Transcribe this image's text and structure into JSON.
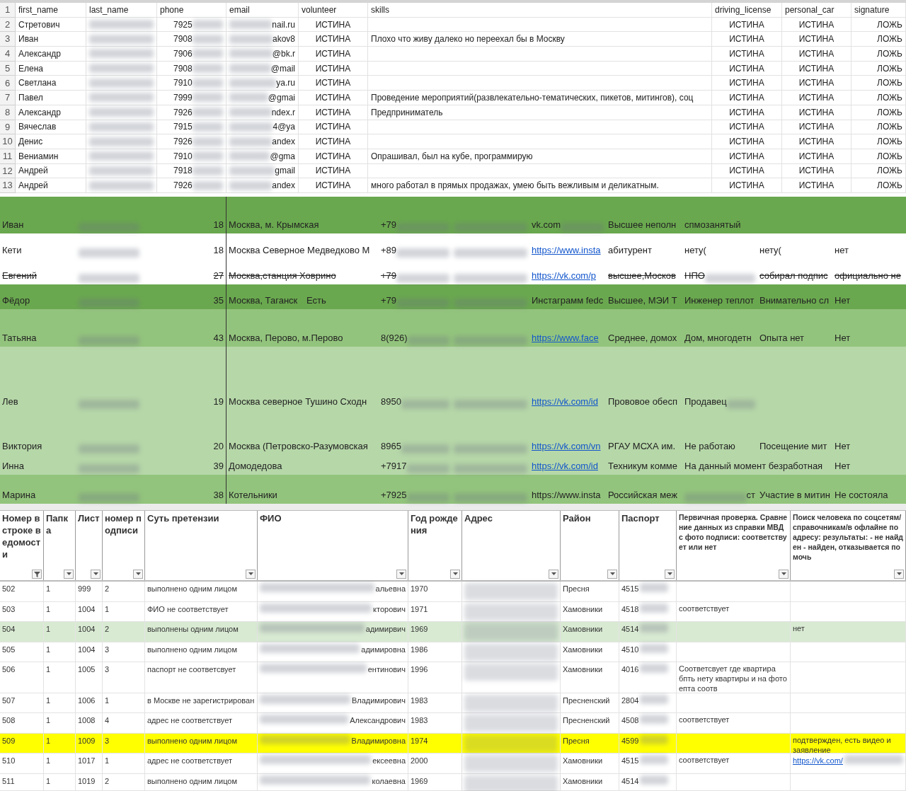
{
  "sheet_1": {
    "header_number": "1",
    "headers": [
      "first_name",
      "last_name",
      "phone",
      "email",
      "volunteer",
      "skills",
      "driving_license",
      "personal_car",
      "signature"
    ],
    "rows": [
      {
        "number": "2",
        "first_name": "Стретович",
        "phone": "7925",
        "email": "nail.ru",
        "volunteer": "ИСТИНА",
        "driving_license": "ИСТИНА",
        "personal_car": "ИСТИНА",
        "signature": "ЛОЖЬ"
      },
      {
        "number": "3",
        "first_name": "Иван",
        "phone": "7908",
        "email": "akov8",
        "volunteer": "ИСТИНА",
        "skills": "Плохо что живу далеко но переехал бы в Москву",
        "driving_license": "ИСТИНА",
        "personal_car": "ИСТИНА",
        "signature": "ЛОЖЬ"
      },
      {
        "number": "4",
        "first_name": "Александр",
        "phone": "7906",
        "email": "@bk.r",
        "volunteer": "ИСТИНА",
        "driving_license": "ИСТИНА",
        "personal_car": "ИСТИНА",
        "signature": "ЛОЖЬ"
      },
      {
        "number": "5",
        "first_name": "Елена",
        "phone": "7908",
        "email": "@mail",
        "volunteer": "ИСТИНА",
        "driving_license": "ИСТИНА",
        "personal_car": "ИСТИНА",
        "signature": "ЛОЖЬ"
      },
      {
        "number": "6",
        "first_name": "Светлана",
        "phone": "7910",
        "email": "ya.ru",
        "volunteer": "ИСТИНА",
        "driving_license": "ИСТИНА",
        "personal_car": "ИСТИНА",
        "signature": "ЛОЖЬ"
      },
      {
        "number": "7",
        "first_name": "Павел",
        "phone": "7999",
        "email": "@gmai",
        "volunteer": "ИСТИНА",
        "skills": "Проведение мероприятий(развлекательно-тематических, пикетов, митингов), соц",
        "driving_license": "ИСТИНА",
        "personal_car": "ИСТИНА",
        "signature": "ЛОЖЬ"
      },
      {
        "number": "8",
        "first_name": "Александр",
        "phone": "7926",
        "email": "ndex.r",
        "volunteer": "ИСТИНА",
        "skills": "Предприниматель",
        "driving_license": "ИСТИНА",
        "personal_car": "ИСТИНА",
        "signature": "ЛОЖЬ"
      },
      {
        "number": "9",
        "first_name": "Вячеслав",
        "phone": "7915",
        "email": "4@ya",
        "volunteer": "ИСТИНА",
        "driving_license": "ИСТИНА",
        "personal_car": "ИСТИНА",
        "signature": "ЛОЖЬ"
      },
      {
        "number": "10",
        "first_name": "Денис",
        "phone": "7926",
        "email": "andex",
        "volunteer": "ИСТИНА",
        "driving_license": "ИСТИНА",
        "personal_car": "ИСТИНА",
        "signature": "ЛОЖЬ"
      },
      {
        "number": "11",
        "first_name": "Вениамин",
        "phone": "7910",
        "email": "@gma",
        "volunteer": "ИСТИНА",
        "skills": "Опрашивал, был на кубе, программирую",
        "driving_license": "ИСТИНА",
        "personal_car": "ИСТИНА",
        "signature": "ЛОЖЬ"
      },
      {
        "number": "12",
        "first_name": "Андрей",
        "phone": "7918",
        "email": "gmail",
        "volunteer": "ИСТИНА",
        "driving_license": "ИСТИНА",
        "personal_car": "ИСТИНА",
        "signature": "ЛОЖЬ"
      },
      {
        "number": "13",
        "first_name": "Андрей",
        "phone": "7926",
        "email": "andex",
        "volunteer": "ИСТИНА",
        "skills": "много работал в прямых продажах, умею быть вежливым и деликатным.",
        "driving_license": "ИСТИНА",
        "personal_car": "ИСТИНА",
        "signature": "ЛОЖЬ"
      }
    ]
  },
  "sheet_2": {
    "rows": [
      {
        "color": "#6aa84f",
        "struck": false,
        "name": "Иван",
        "age": "18",
        "address": "Москва, м. Крымская",
        "phone": "+79",
        "column_8": {
          "text": "vk.com",
          "blur_after": true
        },
        "column_9": "Высшее неполн",
        "column_10": "спмозанятый"
      },
      {
        "color": "#ffffff",
        "struck": false,
        "name": "Кети",
        "age": "18",
        "address": "Москва Северное Медведково М",
        "phone": "+89",
        "column_8": {
          "text": "https://www.insta",
          "link": true
        },
        "column_9": "абитурент",
        "column_10": "нету(",
        "column_11": "нету(",
        "column_12": "нет"
      },
      {
        "color": "#ffffff",
        "struck": true,
        "name": "Евгений",
        "age": "27",
        "address": "Москва,станция Ховрино",
        "phone": "+79",
        "column_8": {
          "text": "https://vk.com/p",
          "link": true
        },
        "column_9": "высшее,Москов",
        "column_10": {
          "text": "НПО",
          "blur_after": true
        },
        "column_11": "собирал подпис",
        "column_12": "официально не"
      },
      {
        "color": "#6aa84f",
        "struck": false,
        "name": "Фёдор",
        "age": "35",
        "address": "Москва, Таганск",
        "column_5": "Есть",
        "phone": "+79",
        "column_8": "Инстаграмм fedc",
        "column_9": "Высшее, МЭИ Т",
        "column_10": "Инженер теплот",
        "column_11": "Внимательно сл",
        "column_12": "Нет"
      },
      {
        "color": "#93c47d",
        "struck": false,
        "name": "Татьяна",
        "age": "43",
        "address": "Москва, Перово, м.Перово",
        "phone": "8(926)",
        "column_8": {
          "text": "https://www.face",
          "link": true
        },
        "column_9": "Среднее, домох",
        "column_10": "Дом, многодетн",
        "column_11": "Опыта нет",
        "column_12": "Нет"
      },
      {
        "color": "#b6d7a8",
        "struck": false,
        "name": "Лев",
        "age": "19",
        "address": "Москва северное Тушино Сходн",
        "phone": "8950",
        "column_8": {
          "text": "https://vk.com/id",
          "link": true
        },
        "column_9": "Прововое обесп",
        "column_10": {
          "text": "Продавец",
          "blur_after": true
        }
      },
      {
        "color": "#b6d7a8",
        "struck": false,
        "name": "Виктория",
        "age": "20",
        "address": "Москва (Петровско-Разумовская",
        "phone": "8965",
        "column_8": {
          "text": "https://vk.com/vn",
          "link": true
        },
        "column_9": "РГАУ МСХА им.",
        "column_10": "Не работаю",
        "column_11": "Посещение мит",
        "column_12": "Нет"
      },
      {
        "color": "#b6d7a8",
        "struck": false,
        "name": "Инна",
        "age": "39",
        "address": "Домодедова",
        "phone": "+7917",
        "column_8": {
          "text": "https://vk.com/id",
          "link": true
        },
        "column_9": "Техникум комме",
        "column_10": "На данный момент безработная",
        "column_12": "Нет"
      },
      {
        "color": "#93c47d",
        "struck": false,
        "name": "Марина",
        "age": "38",
        "address": "Котельники",
        "phone": "+7925",
        "column_8": "https://www.insta",
        "column_9": "Российская меж",
        "column_10": {
          "text": "ст",
          "blur_before": true
        },
        "column_11": "Участие в митин",
        "column_12": "Не состояла"
      }
    ]
  },
  "sheet_3": {
    "headers": [
      {
        "title": "Номер в строке ведомости",
        "filtered": true
      },
      {
        "title": "Папка",
        "filtered": false
      },
      {
        "title": "Лист",
        "filtered": false
      },
      {
        "title": "номер подписи",
        "filtered": false
      },
      {
        "title": "Суть претензии",
        "filtered": false
      },
      {
        "title": "ФИО",
        "filtered": false
      },
      {
        "title": "Год рождения",
        "filtered": false
      },
      {
        "title": "Адрес",
        "filtered": false
      },
      {
        "title": "Район",
        "filtered": false
      },
      {
        "title": "Паспорт",
        "filtered": false
      },
      {
        "title": "Первичная проверка. Сравнение данных из справки МВД с фото подписи: соответствует или нет",
        "filtered": false
      },
      {
        "title": "Поиск человека по соцсетям/справочникам/в офлайне по адресу: результаты: - не найден - найден, отказывается помочь",
        "filtered": false
      }
    ],
    "rows": [
      {
        "number": "502",
        "folder": "1",
        "sheet": "999",
        "signature_no": "2",
        "claim": "выполнено одним лицом",
        "fio": "альевна",
        "year": "1970",
        "district": "Пресня",
        "passport": "4515"
      },
      {
        "number": "503",
        "folder": "1",
        "sheet": "1004",
        "signature_no": "1",
        "claim": "ФИО не соответствует",
        "fio": "кторович",
        "year": "1971",
        "district": "Хамовники",
        "passport": "4518",
        "check": "соответствует"
      },
      {
        "color": "#d9ead3",
        "number": "504",
        "folder": "1",
        "sheet": "1004",
        "signature_no": "2",
        "claim": "выполнены одним лицом",
        "fio": "адимирвич",
        "year": "1969",
        "district": "Хамовники",
        "passport": "4514",
        "search": "нет"
      },
      {
        "number": "505",
        "folder": "1",
        "sheet": "1004",
        "signature_no": "3",
        "claim": "выполнено одним лицом",
        "fio": "адимировна",
        "year": "1986",
        "district": "Хамовники",
        "passport": "4510"
      },
      {
        "number": "506",
        "folder": "1",
        "sheet": "1005",
        "signature_no": "3",
        "claim": "паспорт не соответсвует",
        "fio": "ентинович",
        "year": "1996",
        "district": "Хамовники",
        "passport": "4016",
        "check": "Соответсвует где квартира бпть нету квартиры и на фото епта соотв"
      },
      {
        "number": "507",
        "folder": "1",
        "sheet": "1006",
        "signature_no": "1",
        "claim": "в Москве не зарегистрирован",
        "fio": "Владимирович",
        "year": "1983",
        "district": "Пресненский",
        "passport": "2804"
      },
      {
        "number": "508",
        "folder": "1",
        "sheet": "1008",
        "signature_no": "4",
        "claim": "адрес не соответствует",
        "fio": "Александрович",
        "year": "1983",
        "district": "Пресненский",
        "passport": "4508",
        "check": "соответствует"
      },
      {
        "color": "#ffff00",
        "number": "509",
        "folder": "1",
        "sheet": "1009",
        "signature_no": "3",
        "claim": "выполнено одним лицом",
        "fio": "Владимировна",
        "year": "1974",
        "district": "Пресня",
        "passport": "4599",
        "search": "подтвержден, есть видео и заявление"
      },
      {
        "number": "510",
        "folder": "1",
        "sheet": "1017",
        "signature_no": "1",
        "claim": "адрес не соответствует",
        "fio": "ексеевна",
        "year": "2000",
        "district": "Хамовники",
        "passport": "4515",
        "check": "соответствует",
        "search": {
          "text": "https://vk.com/",
          "link": true,
          "blur_after": true
        }
      },
      {
        "number": "511",
        "folder": "1",
        "sheet": "1019",
        "signature_no": "2",
        "claim": "выполнено одним лицом",
        "fio": "колаевна",
        "year": "1969",
        "district": "Хамовники",
        "passport": "4514"
      }
    ]
  }
}
